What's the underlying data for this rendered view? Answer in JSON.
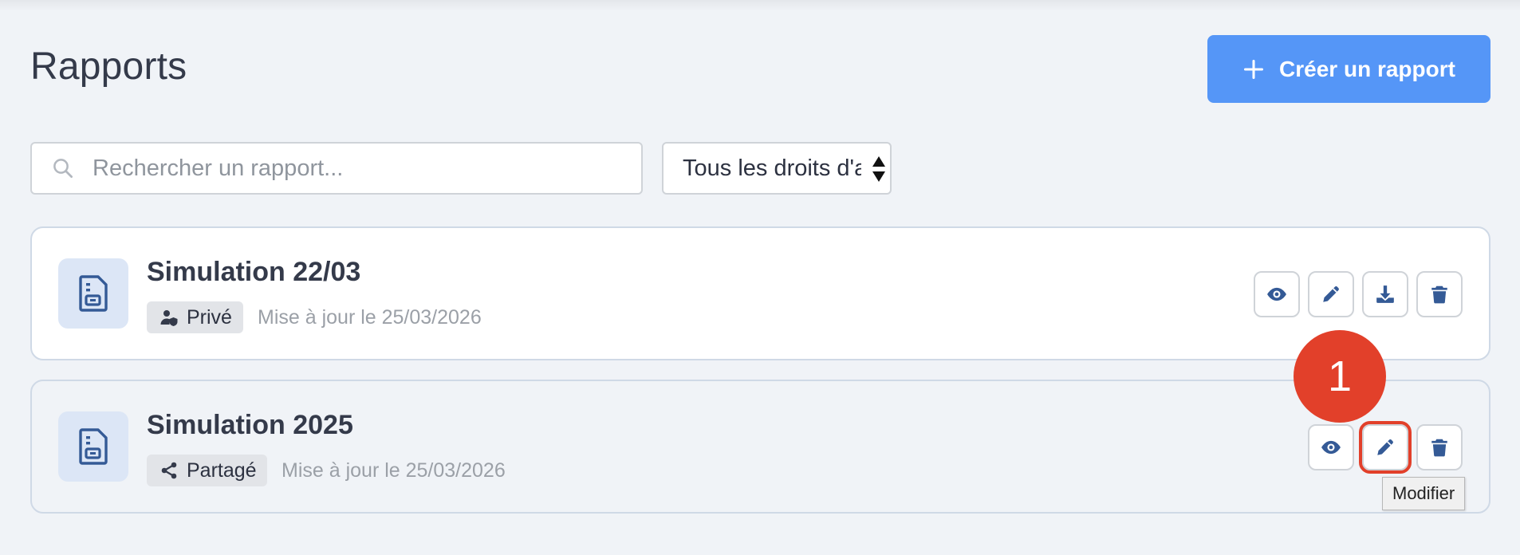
{
  "header": {
    "title": "Rapports",
    "create_button_label": "Créer un rapport"
  },
  "search": {
    "placeholder": "Rechercher un rapport...",
    "value": ""
  },
  "filter": {
    "selected": "Tous les droits d'a"
  },
  "reports": [
    {
      "title": "Simulation 22/03",
      "access_label": "Privé",
      "access_icon": "user-shield-icon",
      "updated": "Mise à jour le 25/03/2026",
      "actions": [
        "view",
        "edit",
        "download",
        "delete"
      ]
    },
    {
      "title": "Simulation 2025",
      "access_label": "Partagé",
      "access_icon": "share-icon",
      "updated": "Mise à jour le 25/03/2026",
      "actions": [
        "view",
        "edit",
        "delete"
      ]
    }
  ],
  "annotation": {
    "step_number": "1",
    "tooltip": "Modifier"
  },
  "colors": {
    "accent": "#5596f7",
    "icon": "#345a96",
    "marker": "#e2402a",
    "background": "#f0f3f7"
  }
}
